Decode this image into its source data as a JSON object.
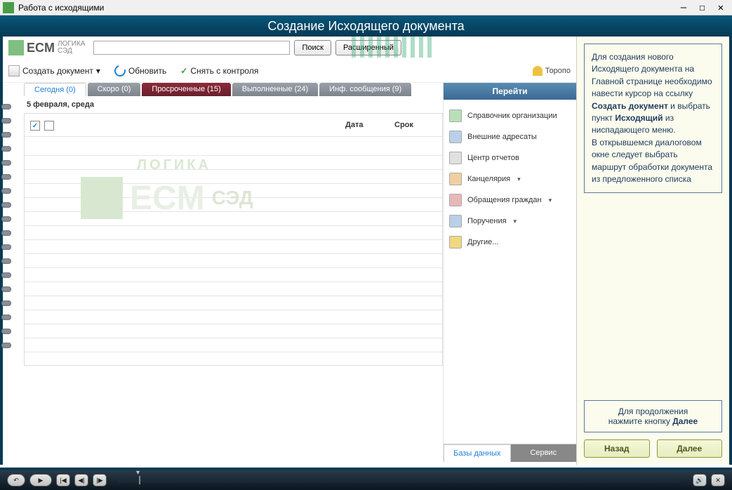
{
  "window": {
    "title": "Работа с исходящими"
  },
  "header": {
    "title": "Создание Исходящего документа"
  },
  "logo": {
    "top": "ЛОГИКА",
    "main": "ECM",
    "sub": "СЭД"
  },
  "search": {
    "placeholder": "",
    "btn_search": "Поиск",
    "btn_adv": "Расширенный"
  },
  "toolbar": {
    "create": "Создать документ",
    "refresh": "Обновить",
    "uncontrol": "Снять с контроля",
    "user": "Торопо"
  },
  "tabs": [
    {
      "label": "Сегодня (0)",
      "active": true
    },
    {
      "label": "Скоро (0)"
    },
    {
      "label": "Просроченные (15)",
      "overdue": true
    },
    {
      "label": "Выполненные (24)"
    },
    {
      "label": "Инф. сообщения (9)"
    }
  ],
  "date_heading": "5 февраля, среда",
  "table": {
    "col_date": "Дата",
    "col_due": "Срок"
  },
  "watermark": {
    "top": "ЛОГИКА",
    "main": "ECM",
    "sub": "СЭД"
  },
  "nav": {
    "header": "Перейти",
    "items": [
      "Справочник организации",
      "Внешние адресаты",
      "Центр отчетов",
      "Канцелярия",
      "Обращения граждан",
      "Поручения",
      "Другие..."
    ]
  },
  "bottom_tabs": {
    "db": "Базы данных",
    "service": "Сервис"
  },
  "help": {
    "p1": "Для создания нового Исходящего документа на Главной странице необходимо навести курсор на ссылку ",
    "b1": "Создать документ",
    "p2": " и выбрать пункт ",
    "b2": "Исходящий",
    "p3": " из ниспадающего меню.",
    "p4": "В открывшемся диалоговом окне следует выбрать маршрут обработки документа из предложенного списка",
    "continue1": "Для продолжения",
    "continue2": "нажмите кнопку ",
    "continue_b": "Далее",
    "back": "Назад",
    "next": "Далее"
  }
}
